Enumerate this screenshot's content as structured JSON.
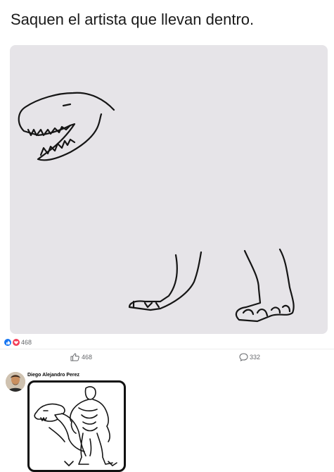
{
  "post": {
    "text": "Saquen el artista que llevan dentro."
  },
  "stats": {
    "reaction_count": "468",
    "reaction_icons": [
      "like-icon",
      "love-icon"
    ]
  },
  "actions": {
    "like_count": "468",
    "comment_count": "332"
  },
  "comment": {
    "author": "Diego Alejandro Perez"
  },
  "colors": {
    "accent": "#1877f2",
    "love": "#f33e58",
    "photo_bg": "#e6e4e8",
    "text_secondary": "#65676b"
  }
}
